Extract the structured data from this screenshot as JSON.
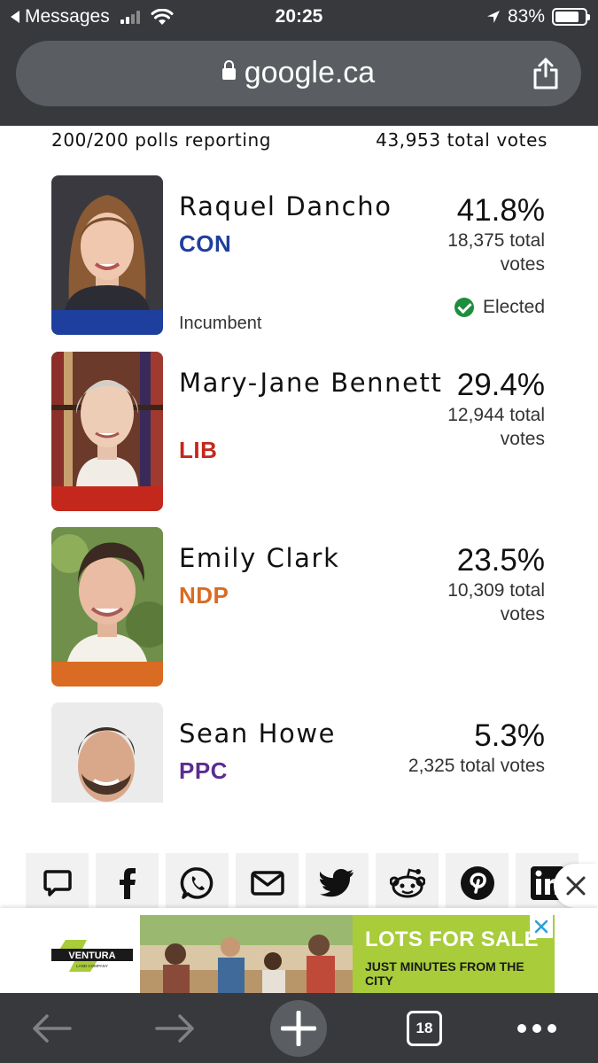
{
  "status_bar": {
    "back_app": "Messages",
    "time": "20:25",
    "battery": "83%",
    "battery_level": 0.83
  },
  "browser": {
    "url": "google.ca",
    "tab_count": "18"
  },
  "results": {
    "polls_reporting": "200/200 polls reporting",
    "total_votes": "43,953 total votes",
    "candidates": [
      {
        "name": "Raquel Dancho",
        "party": "CON",
        "party_color": "#1f3f9e",
        "percent": "41.8%",
        "votes": "18,375 total votes",
        "incumbent_label": "Incumbent",
        "status": "Elected"
      },
      {
        "name": "Mary-Jane Bennett",
        "party": "LIB",
        "party_color": "#c4281c",
        "percent": "29.4%",
        "votes": "12,944 total votes"
      },
      {
        "name": "Emily Clark",
        "party": "NDP",
        "party_color": "#d96c22",
        "percent": "23.5%",
        "votes": "10,309 total votes"
      },
      {
        "name": "Sean Howe",
        "party": "PPC",
        "party_color": "#5b2d91",
        "percent": "5.3%",
        "votes": "2,325 total votes"
      }
    ]
  },
  "share": {
    "icons": [
      "sms-icon",
      "facebook-icon",
      "whatsapp-icon",
      "email-icon",
      "twitter-icon",
      "reddit-icon",
      "pinterest-icon",
      "linkedin-icon"
    ]
  },
  "ad": {
    "brand": "VENTURA",
    "brand_sub": "LAND COMPANY",
    "headline": "LOTS FOR SALE",
    "subline": "JUST MINUTES FROM THE CITY",
    "accent": "#a8cc3a"
  }
}
